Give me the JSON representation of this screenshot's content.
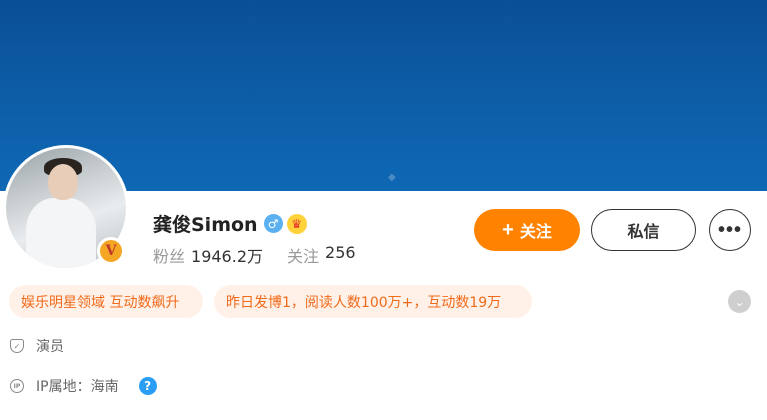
{
  "profile": {
    "name": "龚俊Simon",
    "gender_icon": "male-icon",
    "crown_icon": "crown-icon",
    "verified_badge": "V",
    "fans_label": "粉丝",
    "fans_value": "1946.2万",
    "following_label": "关注",
    "following_value": "256"
  },
  "actions": {
    "follow_plus": "+",
    "follow_label": "关注",
    "message_label": "私信",
    "more_label": "•••"
  },
  "tags": [
    {
      "text": "娱乐明星领域 互动数飙升"
    },
    {
      "text": "昨日发博1，阅读人数100万+，互动数19万"
    }
  ],
  "info": {
    "occupation": "演员",
    "ip_location": "IP属地：海南"
  },
  "colors": {
    "cover": "#0d5ea8",
    "accent": "#ff8200",
    "tag_bg": "#fff1e8",
    "tag_text": "#f06a1a",
    "help": "#2a9df4"
  }
}
